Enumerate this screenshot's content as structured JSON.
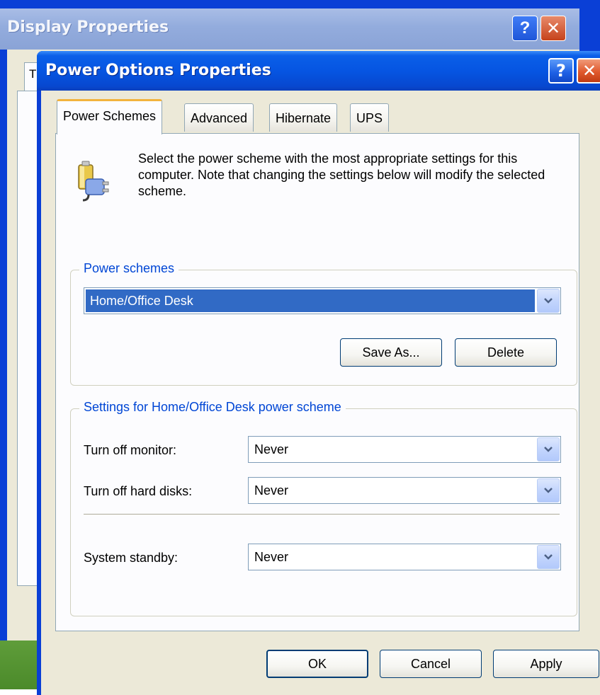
{
  "background_window": {
    "title": "Display Properties",
    "tab_sliver_label": "T",
    "help_glyph": "?",
    "close_glyph": "✕"
  },
  "window": {
    "title": "Power Options Properties",
    "help_glyph": "?",
    "close_glyph": "✕"
  },
  "tabs": [
    {
      "label": "Power Schemes",
      "active": true
    },
    {
      "label": "Advanced",
      "active": false
    },
    {
      "label": "Hibernate",
      "active": false
    },
    {
      "label": "UPS",
      "active": false
    }
  ],
  "intro": {
    "icon": "power-battery-plug-icon",
    "text": "Select the power scheme with the most appropriate settings for this computer. Note that changing the settings below will modify the selected scheme."
  },
  "schemes_group": {
    "title": "Power schemes",
    "selected_scheme": "Home/Office Desk",
    "save_as_label": "Save As...",
    "delete_label": "Delete"
  },
  "settings_group": {
    "title": "Settings for Home/Office Desk power scheme",
    "monitor_label": "Turn off monitor:",
    "monitor_value": "Never",
    "disks_label": "Turn off hard disks:",
    "disks_value": "Never",
    "standby_label": "System standby:",
    "standby_value": "Never"
  },
  "footer": {
    "ok_label": "OK",
    "cancel_label": "Cancel",
    "apply_label": "Apply"
  },
  "colors": {
    "title_blue": "#0655e2",
    "dialog_face": "#ece9d8",
    "group_title": "#0046d5",
    "selection": "#316ac5",
    "active_tab_accent": "#f2b33d"
  }
}
